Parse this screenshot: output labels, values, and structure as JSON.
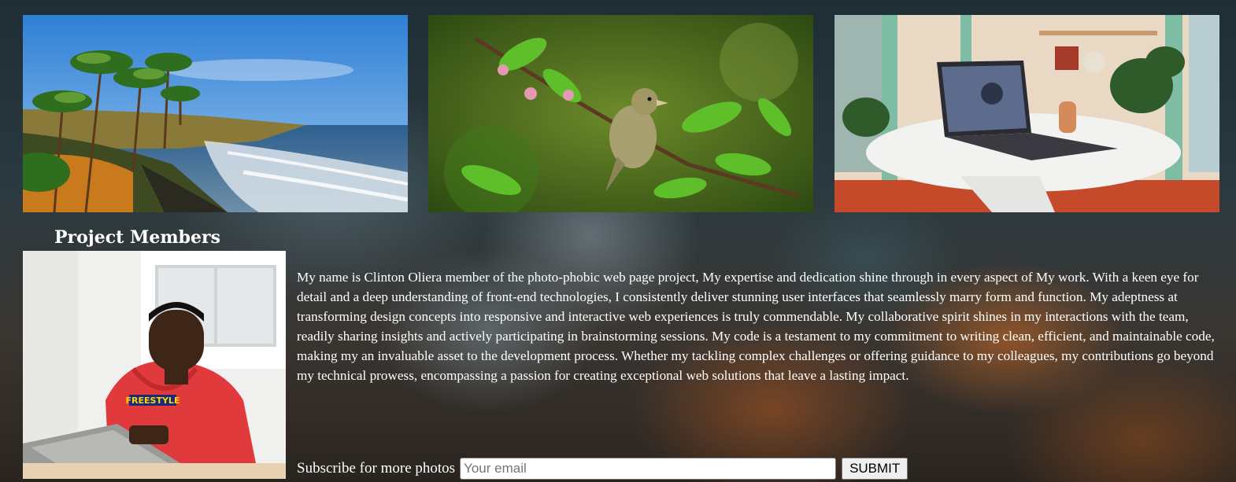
{
  "gallery": {
    "images": [
      {
        "name": "beach-photo",
        "alt": "Palm trees on a coastal cliff beside the sea"
      },
      {
        "name": "bird-photo",
        "alt": "Small bird perched on a leafy branch"
      },
      {
        "name": "laptop-photo",
        "alt": "Laptop on a white marble table"
      }
    ]
  },
  "members": {
    "heading": "Project Members",
    "bio": "My name is Clinton Oliera member of the photo-phobic web page project, My expertise and dedication shine through in every aspect of My work. With a keen eye for detail and a deep understanding of front-end technologies, I consistently deliver stunning user interfaces that seamlessly marry form and function. My adeptness at transforming design concepts into responsive and interactive web experiences is truly commendable. My collaborative spirit shines in my interactions with the team, readily sharing insights and actively participating in brainstorming sessions. My code is a testament to my commitment to writing clean, efficient, and maintainable code, making my an invaluable asset to the development process. Whether my tackling complex challenges or offering guidance to my colleagues, my contributions go beyond my technical prowess, encompassing a passion for creating exceptional web solutions that leave a lasting impact.",
    "photo_alt": "Member portrait: young man in red hoodie with laptop",
    "hoodie_text": "FREESTYLE"
  },
  "subscribe": {
    "label": "Subscribe for more photos",
    "placeholder": "Your email",
    "value": "",
    "button_label": "SUBMIT"
  }
}
